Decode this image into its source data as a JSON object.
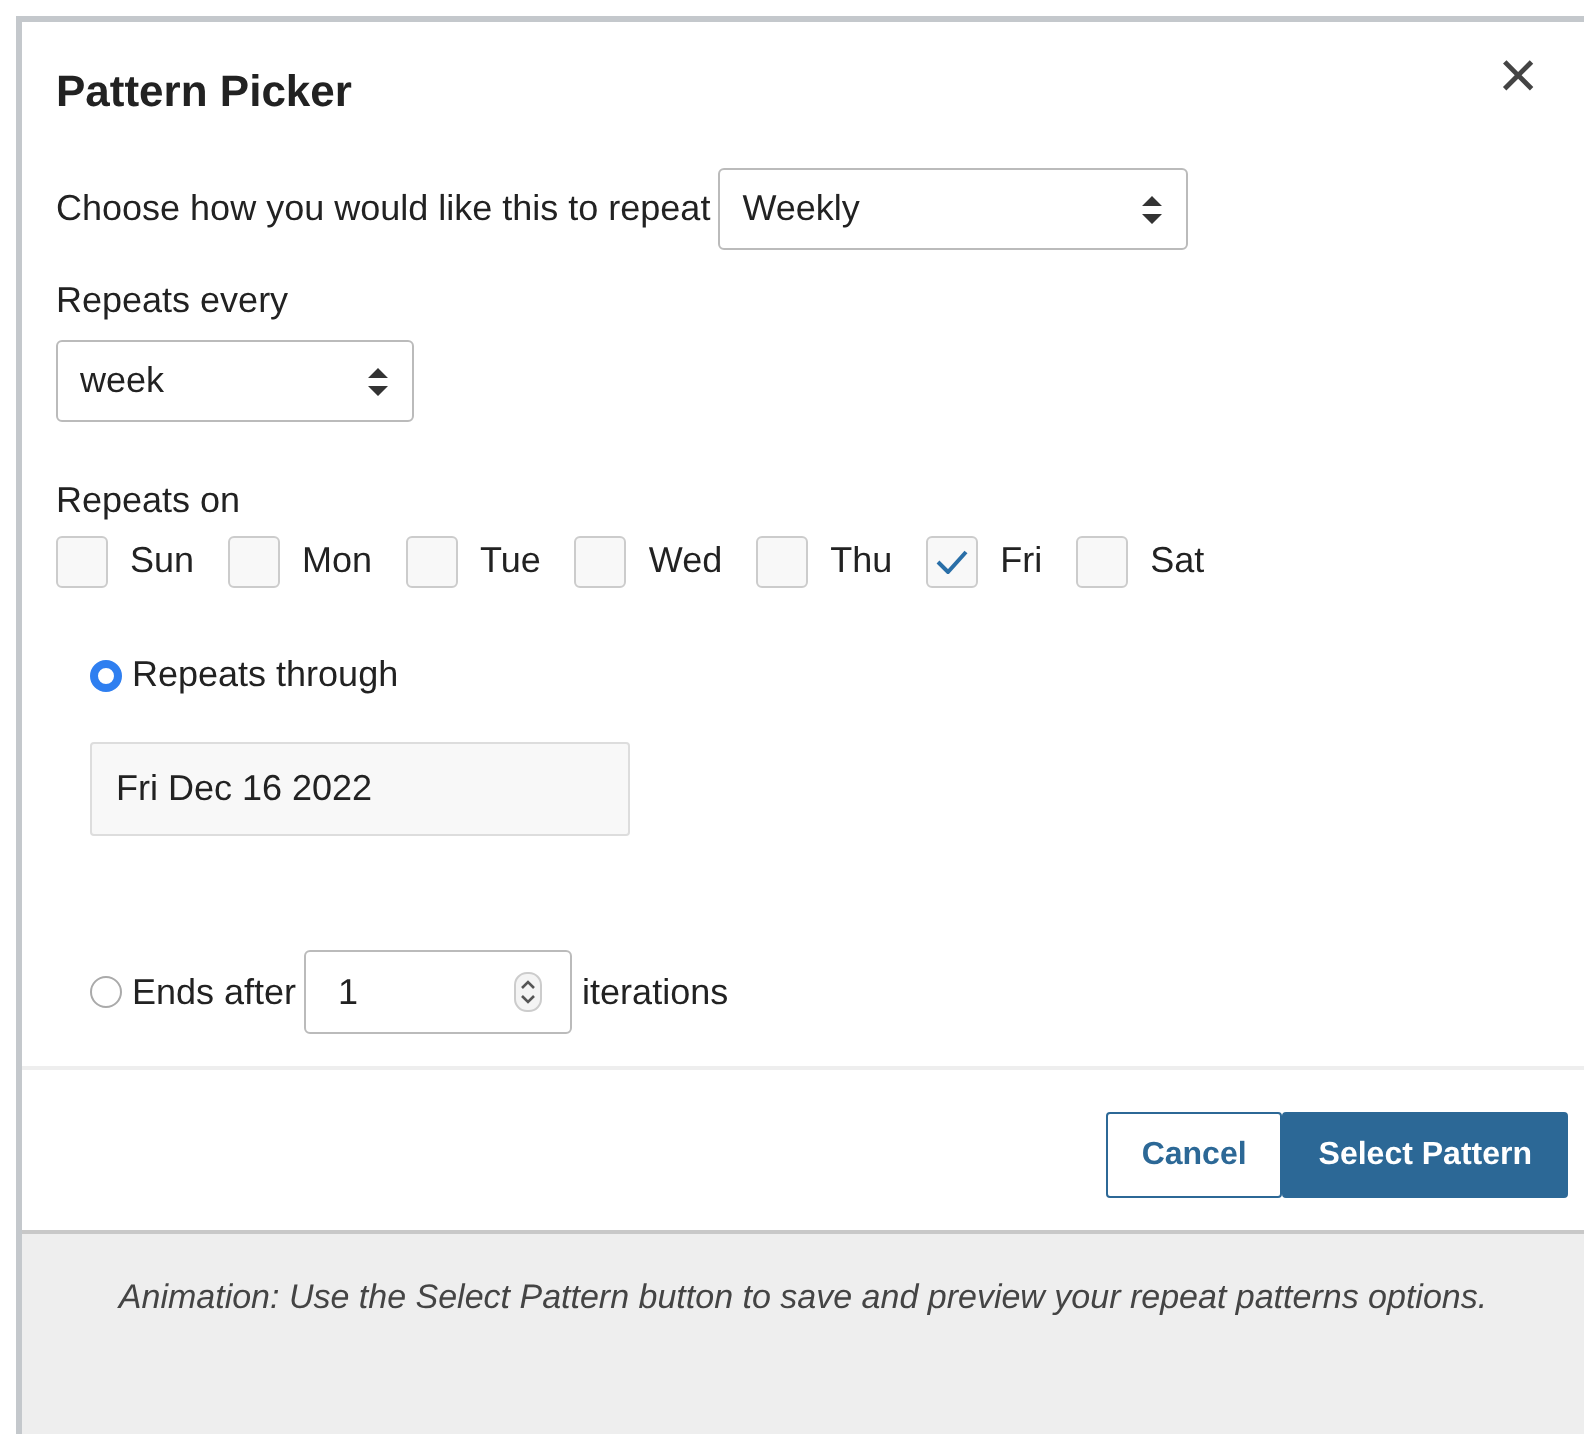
{
  "dialog": {
    "title": "Pattern Picker",
    "close": "×"
  },
  "repeat_type": {
    "label": "Choose how you would like this to repeat",
    "value": "Weekly"
  },
  "repeat_every": {
    "label": "Repeats every",
    "value": "week"
  },
  "repeats_on": {
    "label": "Repeats on",
    "days": [
      {
        "label": "Sun",
        "checked": false
      },
      {
        "label": "Mon",
        "checked": false
      },
      {
        "label": "Tue",
        "checked": false
      },
      {
        "label": "Wed",
        "checked": false
      },
      {
        "label": "Thu",
        "checked": false
      },
      {
        "label": "Fri",
        "checked": true
      },
      {
        "label": "Sat",
        "checked": false
      }
    ]
  },
  "end_options": [
    {
      "kind": "date",
      "label": "Repeats through",
      "selected": true,
      "value": "Fri Dec 16 2022"
    },
    {
      "kind": "count",
      "label": "Ends after",
      "selected": false,
      "value": "1",
      "suffix": "iterations"
    }
  ],
  "buttons": [
    {
      "kind": "secondary",
      "label": "Cancel"
    },
    {
      "kind": "primary",
      "label": "Select Pattern"
    }
  ],
  "caption": "Animation: Use the Select Pattern button to save and preview your repeat patterns options."
}
